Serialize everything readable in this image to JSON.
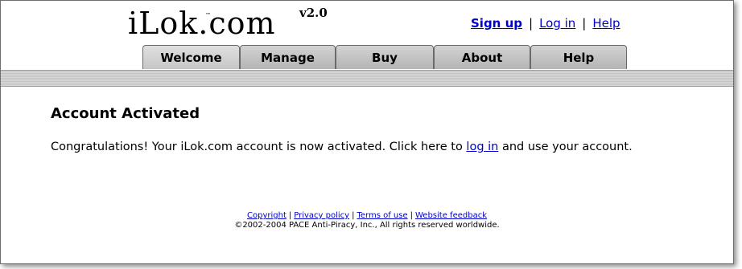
{
  "header": {
    "logo_text": "iLok.com",
    "logo_tm": "™",
    "logo_version": "v2.0",
    "links": {
      "signup": "Sign up",
      "login": "Log in",
      "help": "Help",
      "separator": "|"
    }
  },
  "tabs": [
    {
      "label": "Welcome",
      "active": true
    },
    {
      "label": "Manage",
      "active": false
    },
    {
      "label": "Buy",
      "active": false
    },
    {
      "label": "About",
      "active": false
    },
    {
      "label": "Help",
      "active": false
    }
  ],
  "main": {
    "heading": "Account Activated",
    "message_before": "Congratulations! Your iLok.com account is now activated. Click here to ",
    "message_link": "log in",
    "message_after": " and use your account."
  },
  "footer": {
    "links": {
      "copyright": "Copyright",
      "privacy": "Privacy policy",
      "terms": "Terms of use",
      "feedback": "Website feedback",
      "separator": "|"
    },
    "copyright_text": "©2002-2004 PACE Anti-Piracy, Inc., All rights reserved worldwide."
  },
  "colors": {
    "link": "#0000cc",
    "tab_bg": "#c0c0c0",
    "stripe": "#cfcfcf"
  }
}
